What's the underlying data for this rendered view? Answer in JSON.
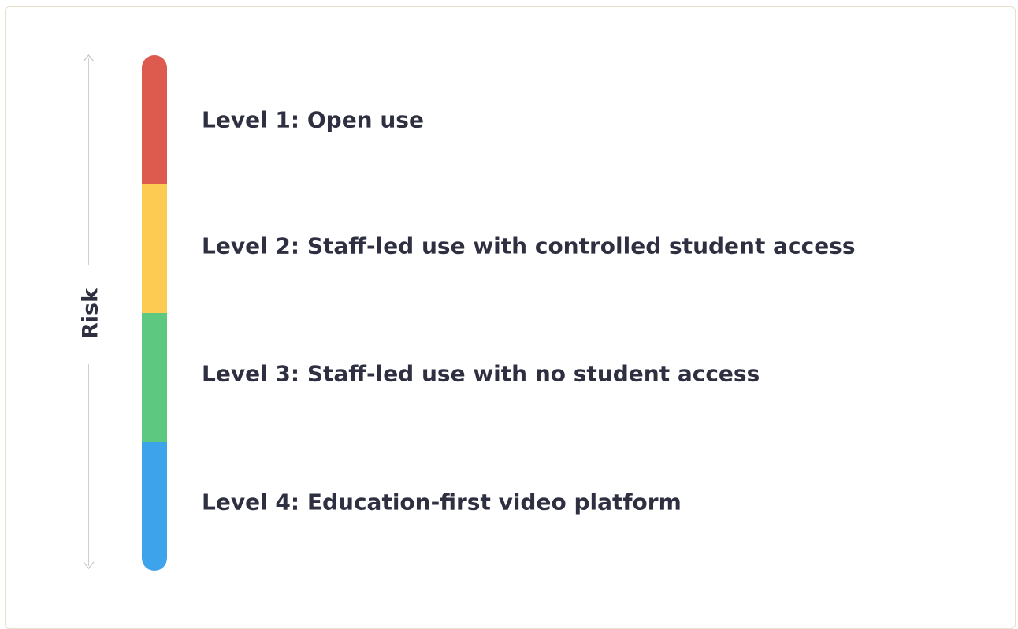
{
  "axis": {
    "label": "Risk"
  },
  "levels": [
    {
      "label": "Level 1: Open use",
      "color": "#dd5a4f"
    },
    {
      "label": "Level 2: Staff-led use with controlled student access",
      "color": "#fdcb51"
    },
    {
      "label": "Level 3: Staff-led use with no student access",
      "color": "#5dc880"
    },
    {
      "label": "Level 4: Education-first video platform",
      "color": "#3da3ea"
    }
  ]
}
